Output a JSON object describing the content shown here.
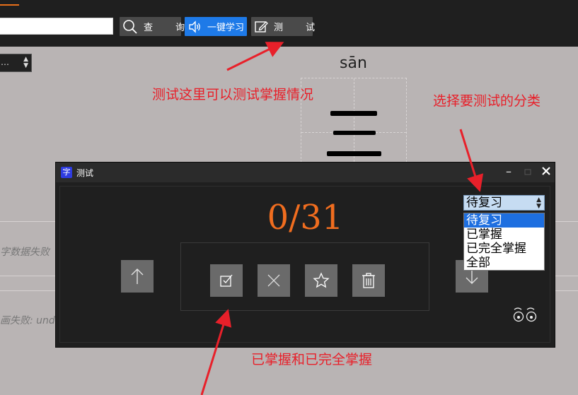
{
  "toolbar": {
    "search_value": "",
    "query_label": "查 询",
    "study_label": "一键学习",
    "test_label": "测 试"
  },
  "category_select": {
    "value": "…"
  },
  "char_card": {
    "pinyin": "sān",
    "character": "三"
  },
  "background_texts": {
    "error_1": "字数据失败",
    "error_2": "画失败: und"
  },
  "dialog": {
    "app_icon": "字",
    "title": "测试",
    "score": "0/31",
    "category": {
      "value": "待复习",
      "options": [
        "待复习",
        "已掌握",
        "已完全掌握",
        "全部"
      ],
      "selected_index": 0
    }
  },
  "annotations": {
    "test_hint": "测试这里可以测试掌握情况",
    "category_hint": "选择要测试的分类",
    "mastered_hint": "已掌握和已完全掌握"
  },
  "colors": {
    "accent_orange": "#f06d1f",
    "primary_blue": "#1e7ae8",
    "annotation_red": "#e8202a"
  }
}
